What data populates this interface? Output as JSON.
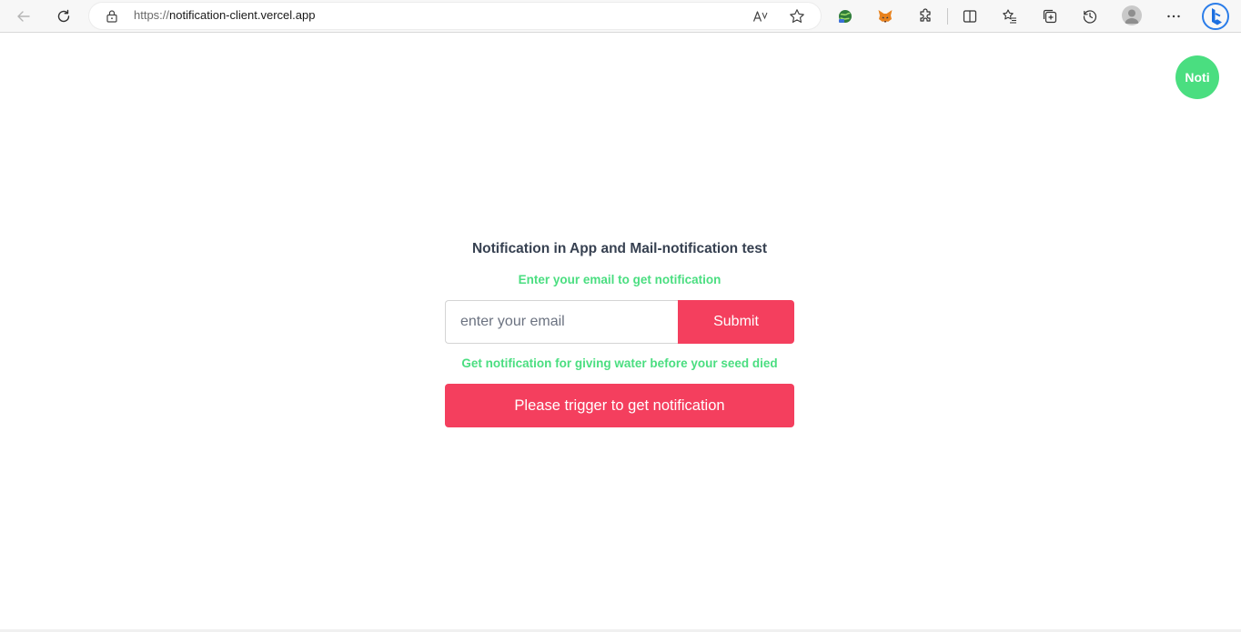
{
  "browser": {
    "url_scheme": "https://",
    "url_host": "notification-client.vercel.app",
    "icons": {
      "back": "back-arrow-icon",
      "refresh": "refresh-icon",
      "lock": "lock-icon",
      "read_aloud": "read-aloud-icon",
      "favorite": "star-icon",
      "extension_1": "globe-extension-icon",
      "extension_2": "metamask-fox-icon",
      "extensions": "puzzle-icon",
      "split_screen": "split-screen-icon",
      "favorites": "favorites-list-icon",
      "collections": "collections-icon",
      "history": "history-icon",
      "profile": "profile-avatar-icon",
      "more": "more-dots-icon",
      "bing": "bing-copilot-icon"
    }
  },
  "noti_badge": {
    "label": "Noti",
    "color": "#4ade80"
  },
  "main": {
    "title": "Notification in App and Mail-notification test",
    "email_subtitle": "Enter your email to get notification",
    "email_input": {
      "value": "",
      "placeholder": "enter your email"
    },
    "submit_label": "Submit",
    "trigger_subtitle": "Get notification for giving water before your seed died",
    "trigger_label": "Please trigger to get notification"
  },
  "colors": {
    "accent_red": "#f43f5e",
    "accent_green": "#4ade80",
    "title_text": "#374151"
  }
}
